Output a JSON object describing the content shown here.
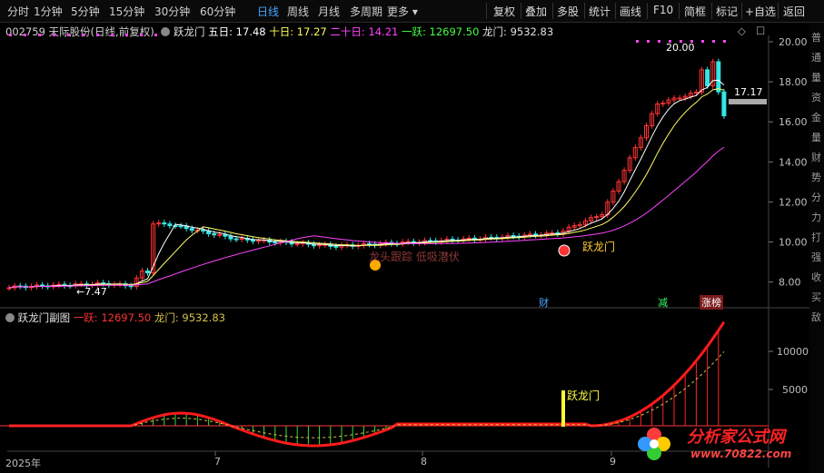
{
  "toolbar": {
    "periods": [
      "分时",
      "1分钟",
      "5分钟",
      "15分钟",
      "30分钟",
      "60分钟",
      "日线",
      "周线",
      "月线",
      "多周期",
      "更多 ▾"
    ],
    "active_period": "日线",
    "actions": [
      "复权",
      "叠加",
      "多股",
      "统计",
      "画线",
      "F10",
      "简框",
      "标记",
      "+自选",
      "返回"
    ]
  },
  "stock": {
    "header": "002759 天际股份(日线,前复权)",
    "indicator_name": "跃龙门",
    "ma5_label": "五日: 17.48",
    "ma10_label": "十日: 17.27",
    "ma20_label": "二十日: 14.21",
    "yiyue_label": "一跃: 12697.50",
    "longmen_label": "龙门: 9532.83"
  },
  "main_chart": {
    "price_ticks": [
      "20.00",
      "18.00",
      "16.00",
      "14.00",
      "12.00",
      "10.00",
      "8.00"
    ],
    "high_label": "20.00",
    "low_label": "7.47",
    "last_label": "17.17",
    "signal_text": "跃龙门",
    "watermark_text": "龙头跟踪 低吸潜伏",
    "tags": [
      "财",
      "减",
      "涨榜"
    ],
    "colors": {
      "up": "#ff3333",
      "down": "#33e6e6",
      "ma5": "#ffffff",
      "ma10": "#ffff66",
      "ma20": "#ff44ff",
      "ma_long": "#ff55ff"
    }
  },
  "sub_chart": {
    "title": "跃龙门副图",
    "yiyue_label": "一跃: 12697.50",
    "longmen_label": "龙门: 9532.83",
    "ticks": [
      "10000",
      "5000"
    ],
    "signal_text": "跃龙门"
  },
  "x_axis": {
    "labels": [
      "2025年",
      "7",
      "8",
      "9"
    ]
  },
  "right_strip": {
    "chars": [
      "普",
      "通",
      "量",
      "资",
      "金",
      "量",
      "财",
      "势",
      "分",
      "力",
      "打",
      "强",
      "收",
      "买",
      "敌"
    ]
  },
  "watermark": {
    "brand": "分析家公式网",
    "url": "www.70822.com"
  }
}
